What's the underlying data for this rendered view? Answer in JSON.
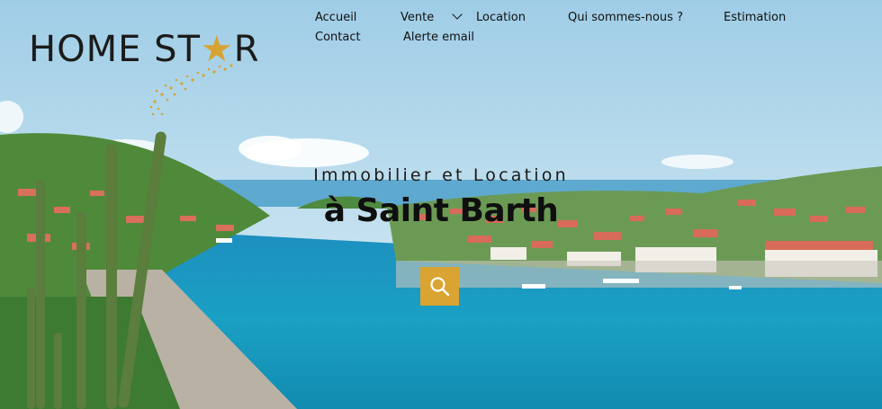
{
  "brand": {
    "name_part1": "HOME ST",
    "name_star": "★",
    "name_part2": "R",
    "accent_color": "#d9a431"
  },
  "nav": {
    "items": [
      {
        "label": "Accueil"
      },
      {
        "label": "Vente"
      },
      {
        "label": "Location"
      },
      {
        "label": "Qui sommes-nous ?"
      },
      {
        "label": "Estimation"
      },
      {
        "label": "Contact"
      },
      {
        "label": "Alerte email"
      }
    ],
    "dropdown_icon": "chevron-down-icon"
  },
  "hero": {
    "subtitle": "Immobilier et Location",
    "title": "à Saint Barth",
    "search_icon": "search-icon"
  }
}
